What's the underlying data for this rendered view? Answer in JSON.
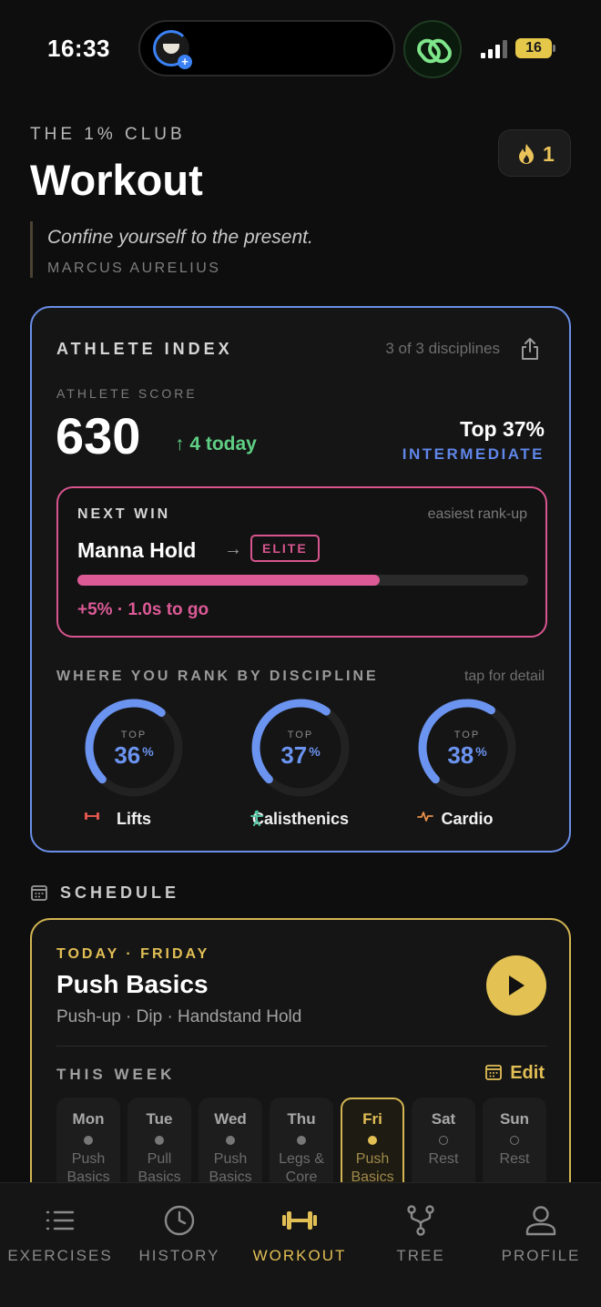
{
  "status_bar": {
    "time": "16:33",
    "battery": "16"
  },
  "header": {
    "eyebrow": "THE 1% CLUB",
    "title": "Workout",
    "streak_count": "1",
    "quote": "Confine yourself to the present.",
    "quote_author": "MARCUS AURELIUS"
  },
  "athlete_index": {
    "title": "ATHLETE INDEX",
    "disciplines_count": "3 of 3 disciplines",
    "score_label": "ATHLETE SCORE",
    "score": "630",
    "score_delta": "↑ 4 today",
    "top_percent": "Top 37%",
    "level": "INTERMEDIATE",
    "accent_color": "#6a8fe8",
    "next_win": {
      "label": "NEXT WIN",
      "hint": "easiest rank-up",
      "exercise": "Manna Hold",
      "target_rank": "ELITE",
      "progress_fraction": 0.67,
      "progress_text": "+5% · 1.0s to go",
      "color": "#dc5a96"
    },
    "rank_label": "WHERE YOU RANK BY DISCIPLINE",
    "rank_hint": "tap for detail",
    "disciplines": [
      {
        "top_label": "TOP",
        "value": "36",
        "unit": "%",
        "name": "Lifts",
        "icon": "dumbbell-icon",
        "percent": 36
      },
      {
        "top_label": "TOP",
        "value": "37",
        "unit": "%",
        "name": "Calisthenics",
        "icon": "person-icon",
        "percent": 37
      },
      {
        "top_label": "TOP",
        "value": "38",
        "unit": "%",
        "name": "Cardio",
        "icon": "heartbeat-icon",
        "percent": 38
      }
    ]
  },
  "schedule": {
    "label": "SCHEDULE",
    "today_label": "TODAY · FRIDAY",
    "today_title": "Push Basics",
    "today_exercises": "Push-up · Dip · Handstand Hold",
    "week_label": "THIS WEEK",
    "edit_label": "Edit",
    "accent_color": "#e2bf55",
    "days": [
      {
        "name": "Mon",
        "line1": "Push",
        "line2": "Basics"
      },
      {
        "name": "Tue",
        "line1": "Pull",
        "line2": "Basics"
      },
      {
        "name": "Wed",
        "line1": "Push",
        "line2": "Basics"
      },
      {
        "name": "Thu",
        "line1": "Legs &",
        "line2": "Core"
      },
      {
        "name": "Fri",
        "line1": "Push",
        "line2": "Basics"
      },
      {
        "name": "Sat",
        "line1": "Rest",
        "line2": ""
      },
      {
        "name": "Sun",
        "line1": "Rest",
        "line2": ""
      }
    ]
  },
  "tabs": [
    {
      "label": "EXERCISES",
      "icon": "list-icon"
    },
    {
      "label": "HISTORY",
      "icon": "clock-icon"
    },
    {
      "label": "WORKOUT",
      "icon": "dumbbell-icon",
      "active": true
    },
    {
      "label": "TREE",
      "icon": "tree-icon"
    },
    {
      "label": "PROFILE",
      "icon": "person-icon"
    }
  ]
}
